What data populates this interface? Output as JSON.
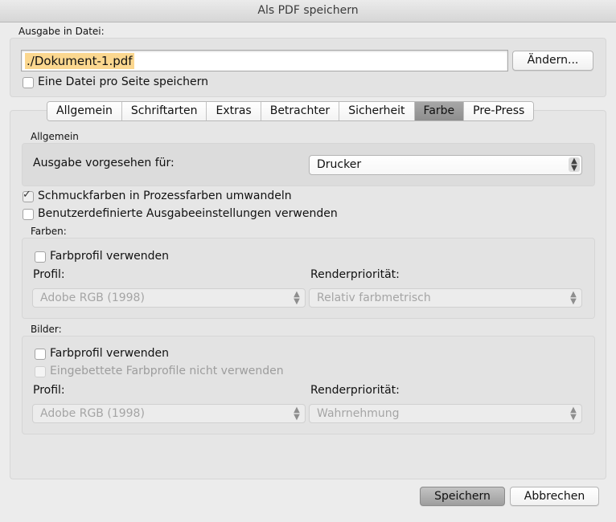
{
  "window": {
    "title": "Als PDF speichern"
  },
  "output": {
    "section_label": "Ausgabe in Datei:",
    "file_value": "./Dokument-1.pdf",
    "change_button": "Ändern...",
    "per_page_checkbox": {
      "label": "Eine Datei pro Seite speichern",
      "checked": false
    }
  },
  "tabs": [
    {
      "label": "Allgemein",
      "active": false
    },
    {
      "label": "Schriftarten",
      "active": false
    },
    {
      "label": "Extras",
      "active": false
    },
    {
      "label": "Betrachter",
      "active": false
    },
    {
      "label": "Sicherheit",
      "active": false
    },
    {
      "label": "Farbe",
      "active": true
    },
    {
      "label": "Pre-Press",
      "active": false
    }
  ],
  "general": {
    "section_label": "Allgemein",
    "intended_label": "Ausgabe vorgesehen für:",
    "intended_value": "Drucker"
  },
  "options": {
    "spot_to_process": {
      "label": "Schmuckfarben in Prozessfarben umwandeln",
      "checked": true
    },
    "custom_output": {
      "label": "Benutzerdefinierte Ausgabeeinstellungen verwenden",
      "checked": false
    }
  },
  "colors": {
    "section_label": "Farben:",
    "use_profile": {
      "label": "Farbprofil verwenden",
      "checked": false
    },
    "profile_label": "Profil:",
    "profile_value": "Adobe RGB (1998)",
    "rendering_label": "Renderpriorität:",
    "rendering_value": "Relativ farbmetrisch"
  },
  "images": {
    "section_label": "Bilder:",
    "use_profile": {
      "label": "Farbprofil verwenden",
      "checked": false
    },
    "no_embedded": {
      "label": "Eingebettete Farbprofile nicht verwenden",
      "checked": false
    },
    "profile_label": "Profil:",
    "profile_value": "Adobe RGB (1998)",
    "rendering_label": "Renderpriorität:",
    "rendering_value": "Wahrnehmung"
  },
  "footer": {
    "save_button": "Speichern",
    "cancel_button": "Abbrechen"
  },
  "colors_theme": {
    "selection": "#fbd78f",
    "window_bg": "#ececec",
    "group_bg": "#e3e3e3"
  }
}
